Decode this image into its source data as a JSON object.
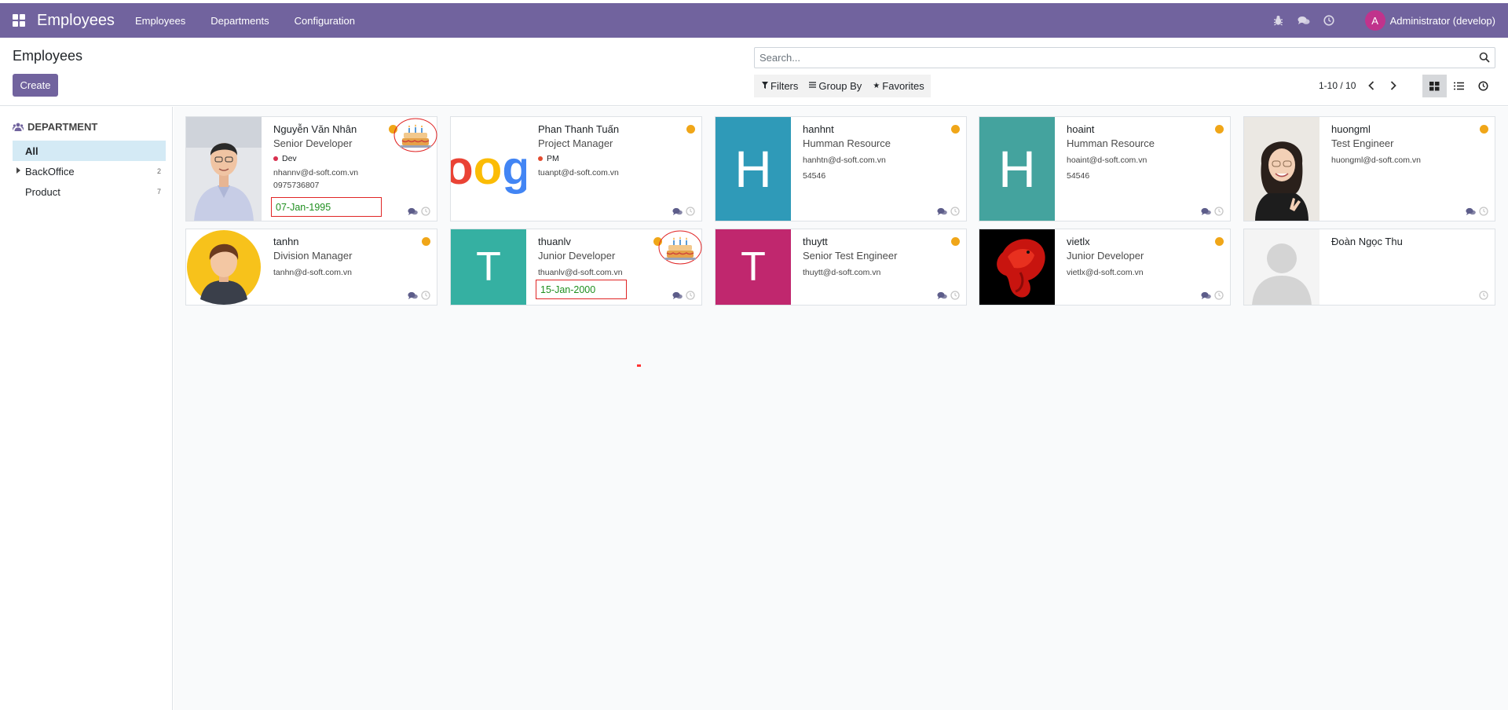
{
  "navbar": {
    "app_title": "Employees",
    "menu": [
      "Employees",
      "Departments",
      "Configuration"
    ],
    "user_initial": "A",
    "user_name": "Administrator (develop)"
  },
  "control": {
    "title": "Employees",
    "create_label": "Create",
    "search_placeholder": "Search...",
    "filters_label": "Filters",
    "groupby_label": "Group By",
    "favorites_label": "Favorites",
    "pager": "1-10 / 10"
  },
  "sidebar": {
    "header": "DEPARTMENT",
    "items": [
      {
        "label": "All",
        "count": ""
      },
      {
        "label": "BackOffice",
        "count": "2"
      },
      {
        "label": "Product",
        "count": "7"
      }
    ]
  },
  "employees": [
    {
      "name": "Nguyễn Văn Nhân",
      "job": "Senior Developer",
      "tag": "Dev",
      "email": "nhannv@d-soft.com.vn",
      "phone": "0975736807",
      "birthday": "07-Jan-1995",
      "image": "photo-man-glasses"
    },
    {
      "name": "Phan Thanh Tuấn",
      "job": "Project Manager",
      "tag": "PM",
      "email": "tuanpt@d-soft.com.vn",
      "image": "google-logo-crop",
      "image_text": "oog"
    },
    {
      "name": "hanhnt",
      "job": "Humman Resource",
      "email": "hanhtn@d-soft.com.vn",
      "phone": "54546",
      "letter": "H",
      "color": "#2f9ab8"
    },
    {
      "name": "hoaint",
      "job": "Humman Resource",
      "email": "hoaint@d-soft.com.vn",
      "phone": "54546",
      "letter": "H",
      "color": "#44a39e"
    },
    {
      "name": "huongml",
      "job": "Test Engineer",
      "email": "huongml@d-soft.com.vn",
      "image": "photo-woman-glasses"
    },
    {
      "name": "tanhn",
      "job": "Division Manager",
      "email": "tanhn@d-soft.com.vn",
      "image": "avatar-cartoon-man"
    },
    {
      "name": "thuanlv",
      "job": "Junior Developer",
      "email": "thuanlv@d-soft.com.vn",
      "birthday": "15-Jan-2000",
      "letter": "T",
      "color": "#35b0a2"
    },
    {
      "name": "thuytt",
      "job": "Senior Test Engineer",
      "email": "thuytt@d-soft.com.vn",
      "letter": "T",
      "color": "#c0276e"
    },
    {
      "name": "vietlx",
      "job": "Junior Developer",
      "email": "vietlx@d-soft.com.vn",
      "image": "photo-red-betta-fish"
    },
    {
      "name": "Đoàn Ngọc Thu",
      "image": "placeholder-person"
    }
  ]
}
